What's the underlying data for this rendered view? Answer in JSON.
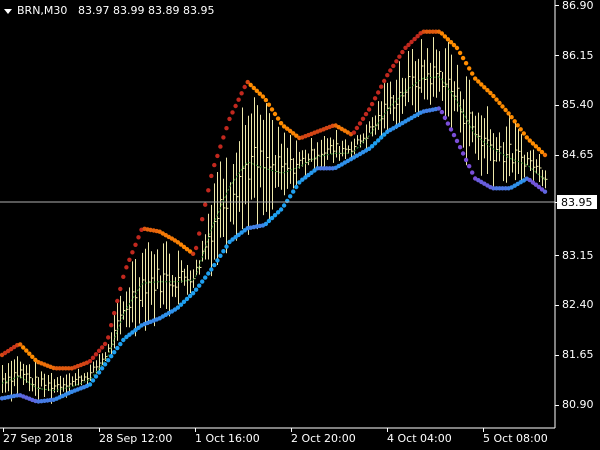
{
  "header": {
    "symbol_timeframe": "BRN,M30",
    "ohlc": "83.97 83.99 83.89 83.95"
  },
  "price_axis": {
    "labels": [
      "86.90",
      "86.15",
      "85.40",
      "84.65",
      "83.95",
      "83.15",
      "82.40",
      "81.65",
      "80.90"
    ],
    "current_price_label": "83.95"
  },
  "time_axis": {
    "labels": [
      "27 Sep 2018",
      "28 Sep 12:00",
      "1 Oct 16:00",
      "2 Oct 20:00",
      "4 Oct 04:00",
      "5 Oct 08:00"
    ]
  },
  "colors": {
    "background": "#000000",
    "price_bars": "#eee8aa",
    "upper_band_high": "#c1281e",
    "upper_band_low": "#ff8c00",
    "lower_band_high": "#1ea0f0",
    "lower_band_low": "#7a4ed8",
    "middle_line": "#2e8b2e",
    "grid_line": "#b0b0b0"
  },
  "chart_data": {
    "type": "line",
    "ylim": [
      80.75,
      87.0
    ],
    "series": [
      {
        "values": [
          81.65,
          81.82,
          81.55,
          81.45,
          81.45,
          81.55,
          81.85,
          82.9,
          83.55,
          83.5,
          83.35,
          83.15,
          84.4,
          85.2,
          85.75,
          85.5,
          85.1,
          84.9,
          85.0,
          85.1,
          84.95,
          85.35,
          85.85,
          86.25,
          86.5,
          86.5,
          86.25,
          85.8,
          85.55,
          85.25,
          84.9,
          84.65
        ]
      },
      {
        "values": [
          81.0,
          81.05,
          80.95,
          80.98,
          81.1,
          81.2,
          81.55,
          81.9,
          82.1,
          82.2,
          82.35,
          82.6,
          82.95,
          83.35,
          83.55,
          83.6,
          83.85,
          84.25,
          84.45,
          84.45,
          84.6,
          84.75,
          85.0,
          85.15,
          85.3,
          85.35,
          84.85,
          84.3,
          84.15,
          84.15,
          84.3,
          84.1
        ]
      }
    ]
  }
}
